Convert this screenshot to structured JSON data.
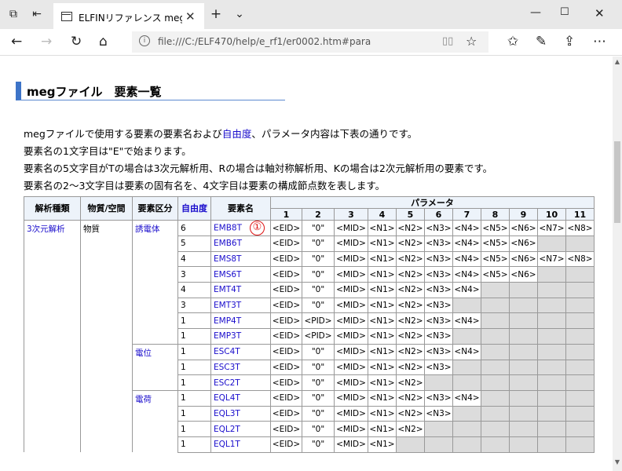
{
  "window": {
    "tab_title": "ELFINリファレンス megファ",
    "url": "file:///C:/ELF470/help/e_rf1/er0002.htm#para"
  },
  "page": {
    "heading": "megファイル　要素一覧",
    "intro": {
      "line1_pre": "megファイルで使用する要素の要素名および",
      "line1_link": "自由度",
      "line1_post": "、パラメータ内容は下表の通りです。",
      "line2": "要素名の1文字目は\"E\"で始まります。",
      "line3": "要素名の5文字目がTの場合は3次元解析用、Rの場合は軸対称解析用、Kの場合は2次元解析用の要素です。",
      "line4": "要素名の2～3文字目は要素の固有名を、4文字目は要素の構成節点数を表します。"
    },
    "table": {
      "headers": {
        "analysis": "解析種類",
        "object": "物質/空間",
        "kind": "要素区分",
        "dof": "自由度",
        "name": "要素名",
        "params": "パラメータ",
        "param_nums": [
          "1",
          "2",
          "3",
          "4",
          "5",
          "6",
          "7",
          "8",
          "9",
          "10",
          "11"
        ]
      },
      "analysis_label": "3次元解析",
      "object_label": "物質",
      "marker": "①",
      "groups": [
        {
          "kind": "誘電体",
          "rows": [
            {
              "dof": "6",
              "name": "EMB8T",
              "params": [
                "<EID>",
                "\"0\"",
                "<MID>",
                "<N1>",
                "<N2>",
                "<N3>",
                "<N4>",
                "<N5>",
                "<N6>",
                "<N7>",
                "<N8>"
              ]
            },
            {
              "dof": "5",
              "name": "EMB6T",
              "params": [
                "<EID>",
                "\"0\"",
                "<MID>",
                "<N1>",
                "<N2>",
                "<N3>",
                "<N4>",
                "<N5>",
                "<N6>",
                "",
                ""
              ]
            },
            {
              "dof": "4",
              "name": "EMS8T",
              "params": [
                "<EID>",
                "\"0\"",
                "<MID>",
                "<N1>",
                "<N2>",
                "<N3>",
                "<N4>",
                "<N5>",
                "<N6>",
                "<N7>",
                "<N8>"
              ]
            },
            {
              "dof": "3",
              "name": "EMS6T",
              "params": [
                "<EID>",
                "\"0\"",
                "<MID>",
                "<N1>",
                "<N2>",
                "<N3>",
                "<N4>",
                "<N5>",
                "<N6>",
                "",
                ""
              ]
            },
            {
              "dof": "4",
              "name": "EMT4T",
              "params": [
                "<EID>",
                "\"0\"",
                "<MID>",
                "<N1>",
                "<N2>",
                "<N3>",
                "<N4>",
                "",
                "",
                "",
                ""
              ]
            },
            {
              "dof": "3",
              "name": "EMT3T",
              "params": [
                "<EID>",
                "\"0\"",
                "<MID>",
                "<N1>",
                "<N2>",
                "<N3>",
                "",
                "",
                "",
                "",
                ""
              ]
            },
            {
              "dof": "1",
              "name": "EMP4T",
              "params": [
                "<EID>",
                "<PID>",
                "<MID>",
                "<N1>",
                "<N2>",
                "<N3>",
                "<N4>",
                "",
                "",
                "",
                ""
              ]
            },
            {
              "dof": "1",
              "name": "EMP3T",
              "params": [
                "<EID>",
                "<PID>",
                "<MID>",
                "<N1>",
                "<N2>",
                "<N3>",
                "",
                "",
                "",
                "",
                ""
              ]
            }
          ]
        },
        {
          "kind": "電位",
          "rows": [
            {
              "dof": "1",
              "name": "ESC4T",
              "params": [
                "<EID>",
                "\"0\"",
                "<MID>",
                "<N1>",
                "<N2>",
                "<N3>",
                "<N4>",
                "",
                "",
                "",
                ""
              ]
            },
            {
              "dof": "1",
              "name": "ESC3T",
              "params": [
                "<EID>",
                "\"0\"",
                "<MID>",
                "<N1>",
                "<N2>",
                "<N3>",
                "",
                "",
                "",
                "",
                ""
              ]
            },
            {
              "dof": "1",
              "name": "ESC2T",
              "params": [
                "<EID>",
                "\"0\"",
                "<MID>",
                "<N1>",
                "<N2>",
                "",
                "",
                "",
                "",
                "",
                ""
              ]
            }
          ]
        },
        {
          "kind": "電荷",
          "rows": [
            {
              "dof": "1",
              "name": "EQL4T",
              "params": [
                "<EID>",
                "\"0\"",
                "<MID>",
                "<N1>",
                "<N2>",
                "<N3>",
                "<N4>",
                "",
                "",
                "",
                ""
              ]
            },
            {
              "dof": "1",
              "name": "EQL3T",
              "params": [
                "<EID>",
                "\"0\"",
                "<MID>",
                "<N1>",
                "<N2>",
                "<N3>",
                "",
                "",
                "",
                "",
                ""
              ]
            },
            {
              "dof": "1",
              "name": "EQL2T",
              "params": [
                "<EID>",
                "\"0\"",
                "<MID>",
                "<N1>",
                "<N2>",
                "",
                "",
                "",
                "",
                "",
                ""
              ]
            },
            {
              "dof": "1",
              "name": "EQL1T",
              "params": [
                "<EID>",
                "\"0\"",
                "<MID>",
                "<N1>",
                "",
                "",
                "",
                "",
                "",
                "",
                ""
              ]
            }
          ]
        }
      ]
    }
  },
  "icons": {
    "tab_actions": "tab-actions-icon",
    "back_tabs": "set-aside-tabs-icon",
    "new_tab": "plus-icon",
    "tab_list": "chevron-down-icon",
    "minimize": "minimize-icon",
    "maximize": "maximize-icon",
    "close": "close-icon",
    "back": "back-arrow-icon",
    "forward": "forward-arrow-icon",
    "refresh": "refresh-icon",
    "home": "home-icon",
    "favorites": "favorites-icon",
    "notes": "pen-icon",
    "share": "share-icon",
    "more": "more-icon"
  },
  "colors": {
    "link": "#1a0dcc",
    "heading_bar": "#3d74c8",
    "header_bg": "#edf3fa",
    "empty_cell": "#dcdcdc",
    "marker": "#dd1111"
  }
}
